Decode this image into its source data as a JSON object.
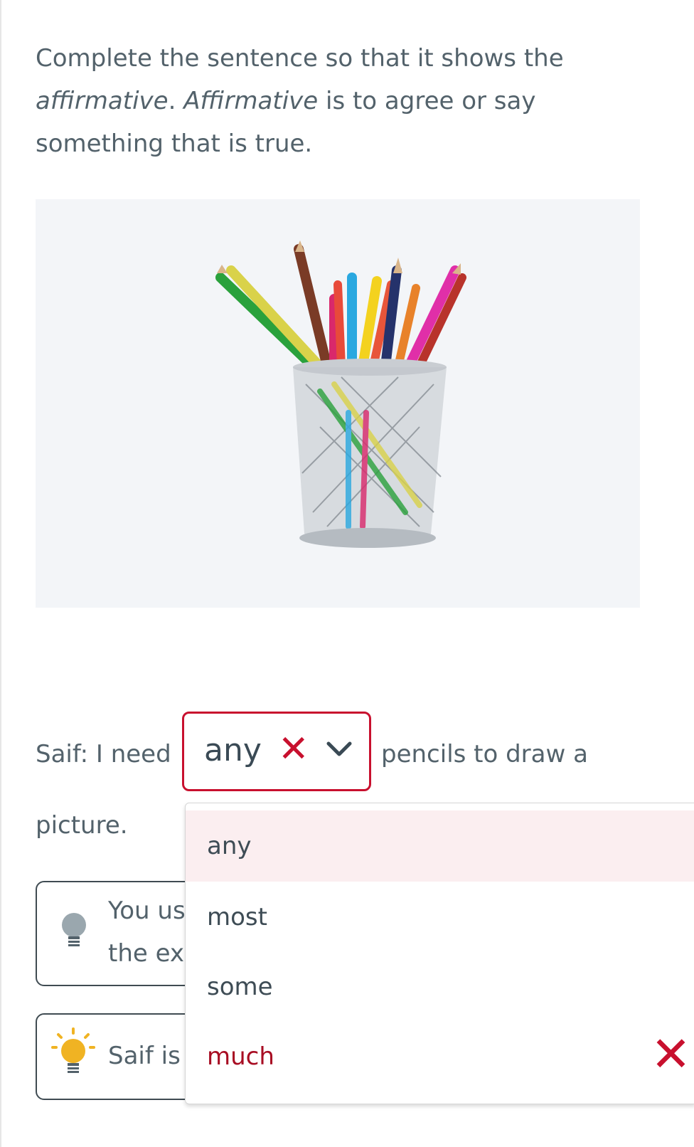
{
  "instructions": {
    "part1": "Complete the sentence so that it shows the",
    "italic1": "affirmative",
    "part2": ". ",
    "italic2": "Affirmative",
    "part3": " is to agree or say something that is true."
  },
  "photo": {
    "icon": "pencil-cup-photo"
  },
  "sentence": {
    "before": "Saif: I need",
    "after": "pencils to draw a",
    "line2": "picture."
  },
  "dropdown": {
    "value": "any",
    "status_icon": "x-icon",
    "status_color": "#c8102e",
    "chevron_icon": "chevron-down-icon"
  },
  "hints": [
    {
      "icon": "lightbulb-off-icon",
      "line1": "You us",
      "line2": "the ex"
    },
    {
      "icon": "lightbulb-on-icon",
      "line1": "Saif is"
    }
  ],
  "options": [
    {
      "label": "any",
      "state": "selected"
    },
    {
      "label": "most",
      "state": ""
    },
    {
      "label": "some",
      "state": ""
    },
    {
      "label": "much",
      "state": "wrong"
    }
  ],
  "colors": {
    "error": "#c8102e",
    "text": "#53626b",
    "selected_bg": "#fbeef0",
    "bulb_on": "#f0b323",
    "bulb_off": "#9aa7ae"
  }
}
